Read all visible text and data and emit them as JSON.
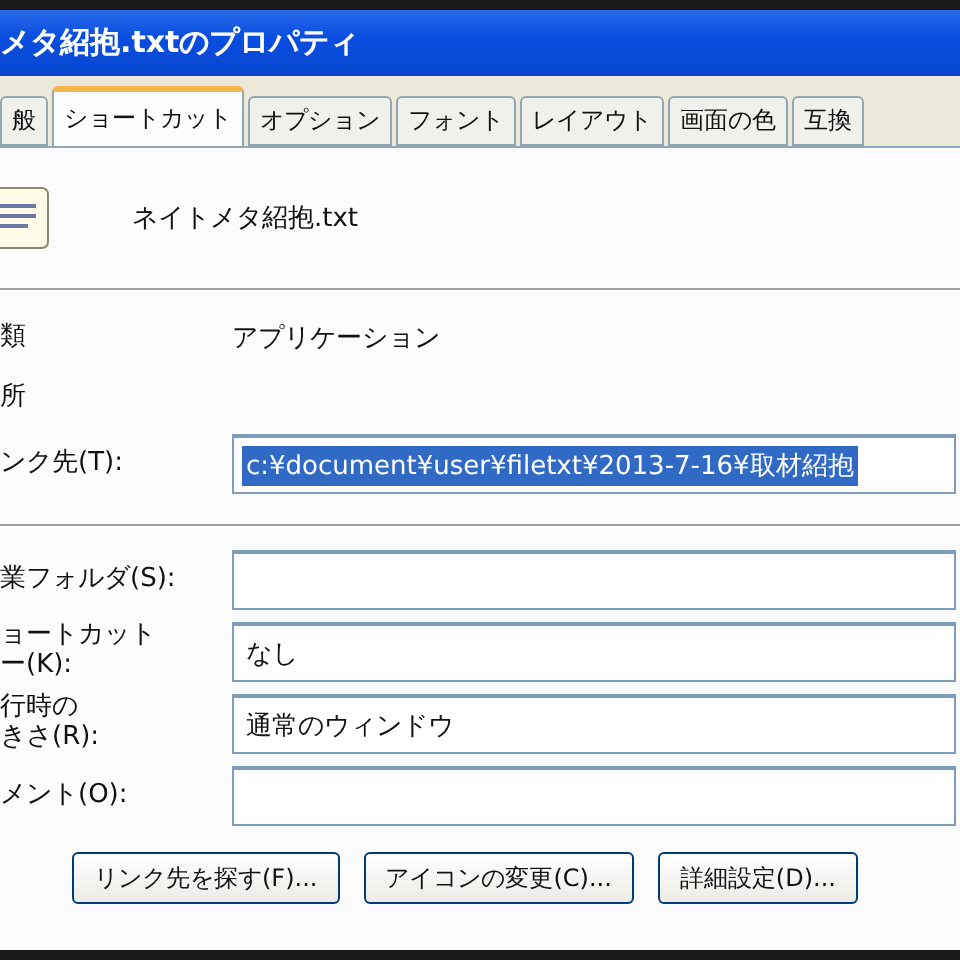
{
  "window": {
    "title": "メタ紹抱.txtのプロパティ"
  },
  "tabs": [
    {
      "label": "般",
      "selected": false
    },
    {
      "label": "ショートカット",
      "selected": true
    },
    {
      "label": "オプション",
      "selected": false
    },
    {
      "label": "フォント",
      "selected": false
    },
    {
      "label": "レイアウト",
      "selected": false
    },
    {
      "label": "画面の色",
      "selected": false
    },
    {
      "label": "互換",
      "selected": false
    }
  ],
  "header": {
    "file_name": "ネイトメタ紹抱.txt"
  },
  "info": [
    {
      "label": "類",
      "value": "アプリケーション"
    },
    {
      "label": "所"
    }
  ],
  "link_field": {
    "label": [
      "ンク先(T):"
    ],
    "value": "c:¥document¥user¥filetxt¥2013-7-16¥取材紹抱",
    "highlighted": true
  },
  "fields": [
    {
      "label": [
        "業フォルダ(S):"
      ]
    },
    {
      "label": [
        "ョートカット",
        "ー(K):"
      ],
      "value": "なし"
    },
    {
      "label": [
        "行時の",
        "きさ(R):"
      ],
      "value": "通常のウィンドウ"
    },
    {
      "label": [
        "メント(O):"
      ]
    }
  ],
  "buttons": [
    "リンク先を探す(F)...",
    "アイコンの変更(C)...",
    "詳細設定(D)..."
  ]
}
